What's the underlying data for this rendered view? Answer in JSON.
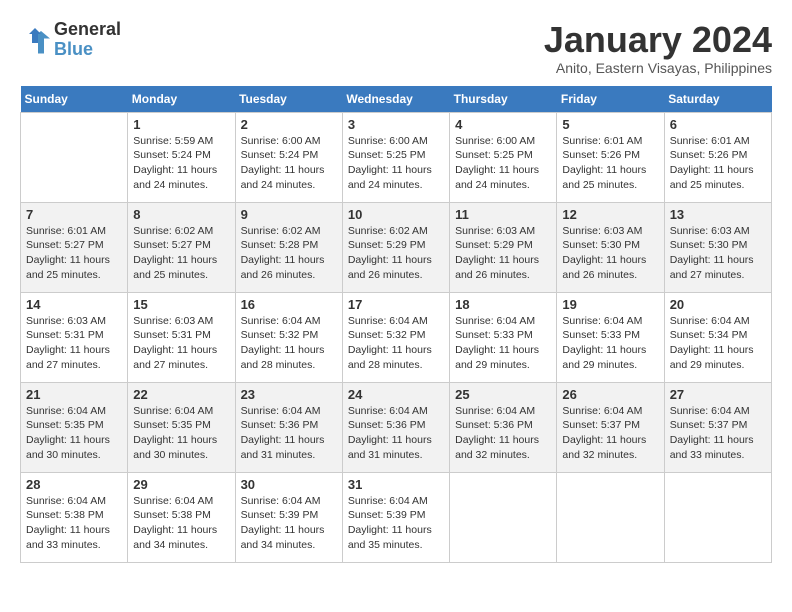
{
  "header": {
    "logo_line1": "General",
    "logo_line2": "Blue",
    "month_title": "January 2024",
    "location": "Anito, Eastern Visayas, Philippines"
  },
  "weekdays": [
    "Sunday",
    "Monday",
    "Tuesday",
    "Wednesday",
    "Thursday",
    "Friday",
    "Saturday"
  ],
  "weeks": [
    [
      {
        "day": "",
        "sunrise": "",
        "sunset": "",
        "daylight": ""
      },
      {
        "day": "1",
        "sunrise": "Sunrise: 5:59 AM",
        "sunset": "Sunset: 5:24 PM",
        "daylight": "Daylight: 11 hours and 24 minutes."
      },
      {
        "day": "2",
        "sunrise": "Sunrise: 6:00 AM",
        "sunset": "Sunset: 5:24 PM",
        "daylight": "Daylight: 11 hours and 24 minutes."
      },
      {
        "day": "3",
        "sunrise": "Sunrise: 6:00 AM",
        "sunset": "Sunset: 5:25 PM",
        "daylight": "Daylight: 11 hours and 24 minutes."
      },
      {
        "day": "4",
        "sunrise": "Sunrise: 6:00 AM",
        "sunset": "Sunset: 5:25 PM",
        "daylight": "Daylight: 11 hours and 24 minutes."
      },
      {
        "day": "5",
        "sunrise": "Sunrise: 6:01 AM",
        "sunset": "Sunset: 5:26 PM",
        "daylight": "Daylight: 11 hours and 25 minutes."
      },
      {
        "day": "6",
        "sunrise": "Sunrise: 6:01 AM",
        "sunset": "Sunset: 5:26 PM",
        "daylight": "Daylight: 11 hours and 25 minutes."
      }
    ],
    [
      {
        "day": "7",
        "sunrise": "Sunrise: 6:01 AM",
        "sunset": "Sunset: 5:27 PM",
        "daylight": "Daylight: 11 hours and 25 minutes."
      },
      {
        "day": "8",
        "sunrise": "Sunrise: 6:02 AM",
        "sunset": "Sunset: 5:27 PM",
        "daylight": "Daylight: 11 hours and 25 minutes."
      },
      {
        "day": "9",
        "sunrise": "Sunrise: 6:02 AM",
        "sunset": "Sunset: 5:28 PM",
        "daylight": "Daylight: 11 hours and 26 minutes."
      },
      {
        "day": "10",
        "sunrise": "Sunrise: 6:02 AM",
        "sunset": "Sunset: 5:29 PM",
        "daylight": "Daylight: 11 hours and 26 minutes."
      },
      {
        "day": "11",
        "sunrise": "Sunrise: 6:03 AM",
        "sunset": "Sunset: 5:29 PM",
        "daylight": "Daylight: 11 hours and 26 minutes."
      },
      {
        "day": "12",
        "sunrise": "Sunrise: 6:03 AM",
        "sunset": "Sunset: 5:30 PM",
        "daylight": "Daylight: 11 hours and 26 minutes."
      },
      {
        "day": "13",
        "sunrise": "Sunrise: 6:03 AM",
        "sunset": "Sunset: 5:30 PM",
        "daylight": "Daylight: 11 hours and 27 minutes."
      }
    ],
    [
      {
        "day": "14",
        "sunrise": "Sunrise: 6:03 AM",
        "sunset": "Sunset: 5:31 PM",
        "daylight": "Daylight: 11 hours and 27 minutes."
      },
      {
        "day": "15",
        "sunrise": "Sunrise: 6:03 AM",
        "sunset": "Sunset: 5:31 PM",
        "daylight": "Daylight: 11 hours and 27 minutes."
      },
      {
        "day": "16",
        "sunrise": "Sunrise: 6:04 AM",
        "sunset": "Sunset: 5:32 PM",
        "daylight": "Daylight: 11 hours and 28 minutes."
      },
      {
        "day": "17",
        "sunrise": "Sunrise: 6:04 AM",
        "sunset": "Sunset: 5:32 PM",
        "daylight": "Daylight: 11 hours and 28 minutes."
      },
      {
        "day": "18",
        "sunrise": "Sunrise: 6:04 AM",
        "sunset": "Sunset: 5:33 PM",
        "daylight": "Daylight: 11 hours and 29 minutes."
      },
      {
        "day": "19",
        "sunrise": "Sunrise: 6:04 AM",
        "sunset": "Sunset: 5:33 PM",
        "daylight": "Daylight: 11 hours and 29 minutes."
      },
      {
        "day": "20",
        "sunrise": "Sunrise: 6:04 AM",
        "sunset": "Sunset: 5:34 PM",
        "daylight": "Daylight: 11 hours and 29 minutes."
      }
    ],
    [
      {
        "day": "21",
        "sunrise": "Sunrise: 6:04 AM",
        "sunset": "Sunset: 5:35 PM",
        "daylight": "Daylight: 11 hours and 30 minutes."
      },
      {
        "day": "22",
        "sunrise": "Sunrise: 6:04 AM",
        "sunset": "Sunset: 5:35 PM",
        "daylight": "Daylight: 11 hours and 30 minutes."
      },
      {
        "day": "23",
        "sunrise": "Sunrise: 6:04 AM",
        "sunset": "Sunset: 5:36 PM",
        "daylight": "Daylight: 11 hours and 31 minutes."
      },
      {
        "day": "24",
        "sunrise": "Sunrise: 6:04 AM",
        "sunset": "Sunset: 5:36 PM",
        "daylight": "Daylight: 11 hours and 31 minutes."
      },
      {
        "day": "25",
        "sunrise": "Sunrise: 6:04 AM",
        "sunset": "Sunset: 5:36 PM",
        "daylight": "Daylight: 11 hours and 32 minutes."
      },
      {
        "day": "26",
        "sunrise": "Sunrise: 6:04 AM",
        "sunset": "Sunset: 5:37 PM",
        "daylight": "Daylight: 11 hours and 32 minutes."
      },
      {
        "day": "27",
        "sunrise": "Sunrise: 6:04 AM",
        "sunset": "Sunset: 5:37 PM",
        "daylight": "Daylight: 11 hours and 33 minutes."
      }
    ],
    [
      {
        "day": "28",
        "sunrise": "Sunrise: 6:04 AM",
        "sunset": "Sunset: 5:38 PM",
        "daylight": "Daylight: 11 hours and 33 minutes."
      },
      {
        "day": "29",
        "sunrise": "Sunrise: 6:04 AM",
        "sunset": "Sunset: 5:38 PM",
        "daylight": "Daylight: 11 hours and 34 minutes."
      },
      {
        "day": "30",
        "sunrise": "Sunrise: 6:04 AM",
        "sunset": "Sunset: 5:39 PM",
        "daylight": "Daylight: 11 hours and 34 minutes."
      },
      {
        "day": "31",
        "sunrise": "Sunrise: 6:04 AM",
        "sunset": "Sunset: 5:39 PM",
        "daylight": "Daylight: 11 hours and 35 minutes."
      },
      {
        "day": "",
        "sunrise": "",
        "sunset": "",
        "daylight": ""
      },
      {
        "day": "",
        "sunrise": "",
        "sunset": "",
        "daylight": ""
      },
      {
        "day": "",
        "sunrise": "",
        "sunset": "",
        "daylight": ""
      }
    ]
  ]
}
